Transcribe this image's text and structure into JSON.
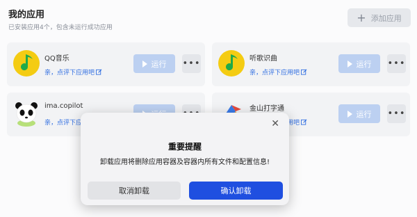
{
  "header": {
    "title": "我的应用",
    "subtitle": "已安装应用4个，包含未运行成功应用",
    "add_button_label": "添加应用"
  },
  "apps": [
    {
      "name": "QQ音乐",
      "rate_text": "亲，点评下应用吧",
      "run_label": "运行",
      "icon": "qq-music-icon"
    },
    {
      "name": "听歌识曲",
      "rate_text": "亲，点评下应用吧",
      "run_label": "运行",
      "icon": "music-recognition-icon"
    },
    {
      "name": "ima.copilot",
      "rate_text": "亲，点评下应用吧",
      "run_label": "运行",
      "icon": "panda-icon"
    },
    {
      "name": "金山打字通",
      "rate_text": "亲，点评下应用吧",
      "run_label": "运行",
      "icon": "typing-app-icon"
    }
  ],
  "dialog": {
    "title": "重要提醒",
    "message": "卸载应用将删除应用容器及容器内所有文件和配置信息!",
    "cancel_label": "取消卸载",
    "confirm_label": "确认卸载"
  },
  "colors": {
    "accent": "#1f4fe0",
    "link": "#2f6de1",
    "run_disabled": "#bcd0f1",
    "qq_music_yellow": "#f4cc13"
  }
}
